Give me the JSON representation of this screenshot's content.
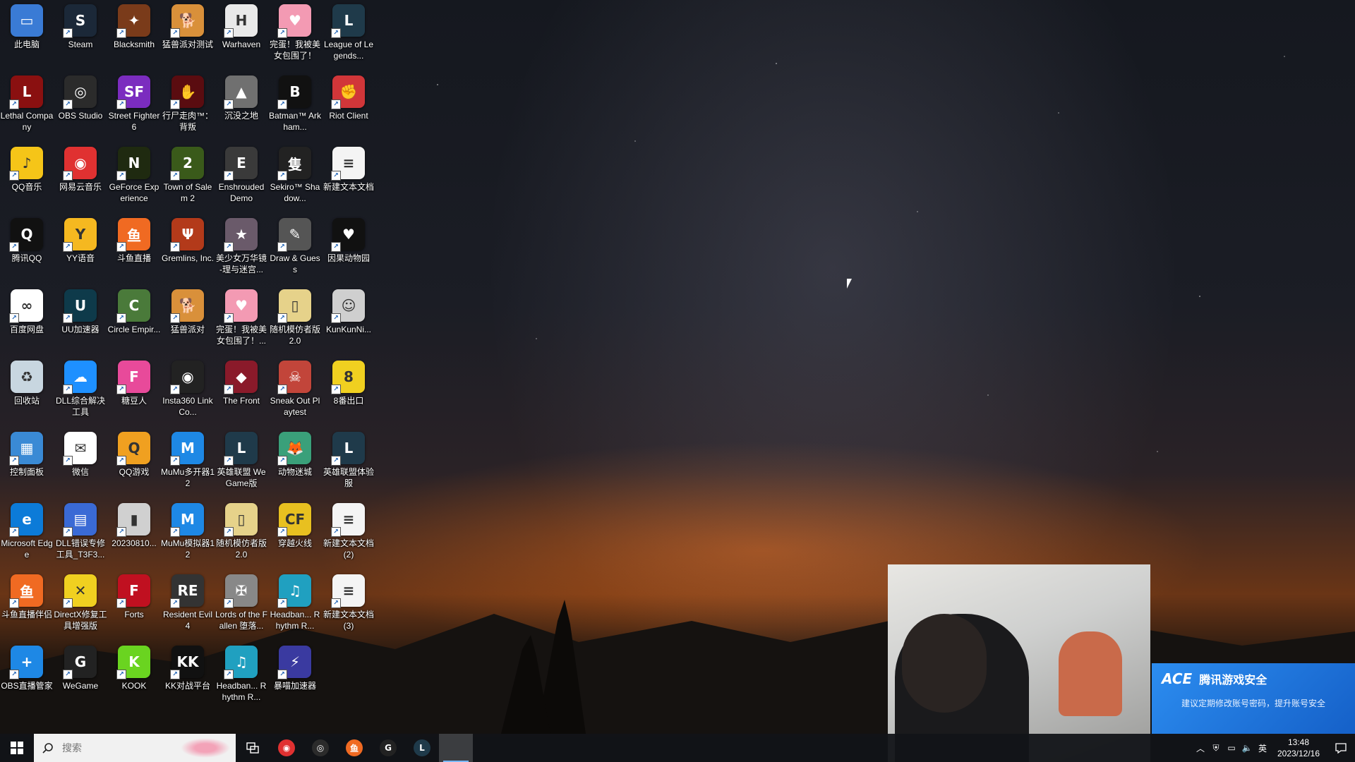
{
  "desktop": {
    "icons": [
      {
        "label": "此电脑",
        "color": "#3a7bd5",
        "glyph": "▭"
      },
      {
        "label": "Steam",
        "color": "#1b2838",
        "glyph": "S"
      },
      {
        "label": "Blacksmith",
        "color": "#7a3b1a",
        "glyph": "✦"
      },
      {
        "label": "猛兽派对测试",
        "color": "#d9903a",
        "glyph": "🐕"
      },
      {
        "label": "Warhaven",
        "color": "#e9e9e9",
        "glyph": "H"
      },
      {
        "label": "完蛋！我被美女包围了！",
        "color": "#f39ab3",
        "glyph": "♥"
      },
      {
        "label": "League of Legends...",
        "color": "#1f3a4a",
        "glyph": "L"
      },
      {
        "label": "Lethal Company",
        "color": "#8a1010",
        "glyph": "L"
      },
      {
        "label": "OBS Studio",
        "color": "#2b2b2b",
        "glyph": "◎"
      },
      {
        "label": "Street Fighter 6",
        "color": "#7b2cbf",
        "glyph": "SF"
      },
      {
        "label": "行尸走肉™：背叛",
        "color": "#5a0c10",
        "glyph": "✋"
      },
      {
        "label": "沉没之地",
        "color": "#707070",
        "glyph": "▲"
      },
      {
        "label": "Batman™ Arkham...",
        "color": "#111111",
        "glyph": "B"
      },
      {
        "label": "Riot Client",
        "color": "#d13639",
        "glyph": "✊"
      },
      {
        "label": "QQ音乐",
        "color": "#f5c518",
        "glyph": "♪"
      },
      {
        "label": "网易云音乐",
        "color": "#e03131",
        "glyph": "◉"
      },
      {
        "label": "GeForce Experience",
        "color": "#1f2a10",
        "glyph": "N"
      },
      {
        "label": "Town of Salem 2",
        "color": "#3a5a1a",
        "glyph": "2"
      },
      {
        "label": "Enshrouded Demo",
        "color": "#3a3a3a",
        "glyph": "E"
      },
      {
        "label": "Sekiro™ Shadow...",
        "color": "#222222",
        "glyph": "隻"
      },
      {
        "label": "新建文本文档",
        "color": "#f4f4f4",
        "glyph": "≡"
      },
      {
        "label": "腾讯QQ",
        "color": "#111111",
        "glyph": "Q"
      },
      {
        "label": "YY语音",
        "color": "#f5b820",
        "glyph": "Y"
      },
      {
        "label": "斗鱼直播",
        "color": "#f06a22",
        "glyph": "鱼"
      },
      {
        "label": "Gremlins, Inc.",
        "color": "#b33a1a",
        "glyph": "Ψ"
      },
      {
        "label": "美少女万华镜 -理与迷宫...",
        "color": "#6a5a6a",
        "glyph": "★"
      },
      {
        "label": "Draw & Guess",
        "color": "#555555",
        "glyph": "✎"
      },
      {
        "label": "因果动物园",
        "color": "#111111",
        "glyph": "♥"
      },
      {
        "label": "百度网盘",
        "color": "#ffffff",
        "glyph": "∞"
      },
      {
        "label": "UU加速器",
        "color": "#0e3a4a",
        "glyph": "U"
      },
      {
        "label": "Circle Empir...",
        "color": "#4a7a3a",
        "glyph": "C"
      },
      {
        "label": "猛兽派对",
        "color": "#d9903a",
        "glyph": "🐕"
      },
      {
        "label": "完蛋！我被美女包围了！...",
        "color": "#f39ab3",
        "glyph": "♥"
      },
      {
        "label": "随机模仿者版 2.0",
        "color": "#e6d28a",
        "glyph": "▯"
      },
      {
        "label": "KunKunNi...",
        "color": "#cfcfcf",
        "glyph": "☺"
      },
      {
        "label": "回收站",
        "color": "#c8d6e0",
        "glyph": "♻"
      },
      {
        "label": "DLL综合解决工具",
        "color": "#1e90ff",
        "glyph": "☁"
      },
      {
        "label": "糖豆人",
        "color": "#e84a9a",
        "glyph": "F"
      },
      {
        "label": "Insta360 Link Co...",
        "color": "#222222",
        "glyph": "◉"
      },
      {
        "label": "The Front",
        "color": "#8a1a2a",
        "glyph": "◆"
      },
      {
        "label": "Sneak Out Playtest",
        "color": "#c2453a",
        "glyph": "☠"
      },
      {
        "label": "8番出口",
        "color": "#f0d020",
        "glyph": "8"
      },
      {
        "label": "控制面板",
        "color": "#3a8ad5",
        "glyph": "▦"
      },
      {
        "label": "微信",
        "color": "#ffffff",
        "glyph": "✉"
      },
      {
        "label": "QQ游戏",
        "color": "#f0a020",
        "glyph": "Q"
      },
      {
        "label": "MuMu多开器12",
        "color": "#1e88e5",
        "glyph": "M"
      },
      {
        "label": "英雄联盟 WeGame版",
        "color": "#1f3a4a",
        "glyph": "L"
      },
      {
        "label": "动物迷城",
        "color": "#3aa07a",
        "glyph": "🦊"
      },
      {
        "label": "英雄联盟体验服",
        "color": "#1f3a4a",
        "glyph": "L"
      },
      {
        "label": "Microsoft Edge",
        "color": "#0c7bd8",
        "glyph": "e"
      },
      {
        "label": "DLL错误专修工具_T3F3...",
        "color": "#3a6ad5",
        "glyph": "▤"
      },
      {
        "label": "20230810...",
        "color": "#d0d0d0",
        "glyph": "▮"
      },
      {
        "label": "MuMu模拟器12",
        "color": "#1e88e5",
        "glyph": "M"
      },
      {
        "label": "随机模仿者版 2.0",
        "color": "#e6d28a",
        "glyph": "▯"
      },
      {
        "label": "穿越火线",
        "color": "#e8c020",
        "glyph": "CF"
      },
      {
        "label": "新建文本文档 (2)",
        "color": "#f4f4f4",
        "glyph": "≡"
      },
      {
        "label": "斗鱼直播伴侣",
        "color": "#f06a22",
        "glyph": "鱼"
      },
      {
        "label": "DirectX修复工具增强版",
        "color": "#f0d020",
        "glyph": "✕"
      },
      {
        "label": "Forts",
        "color": "#c01020",
        "glyph": "F"
      },
      {
        "label": "Resident Evil 4",
        "color": "#333333",
        "glyph": "RE"
      },
      {
        "label": "Lords of the Fallen 堕落...",
        "color": "#888888",
        "glyph": "✠"
      },
      {
        "label": "Headban... Rhythm R...",
        "color": "#20a0c0",
        "glyph": "♫"
      },
      {
        "label": "新建文本文档 (3)",
        "color": "#f4f4f4",
        "glyph": "≡"
      },
      {
        "label": "OBS直播管家",
        "color": "#1e88e5",
        "glyph": "+"
      },
      {
        "label": "WeGame",
        "color": "#222222",
        "glyph": "G"
      },
      {
        "label": "KOOK",
        "color": "#6ad420",
        "glyph": "K"
      },
      {
        "label": "KK对战平台",
        "color": "#111111",
        "glyph": "KK"
      },
      {
        "label": "Headban... Rhythm R...",
        "color": "#20a0c0",
        "glyph": "♫"
      },
      {
        "label": "暴喵加速器",
        "color": "#3a3aa0",
        "glyph": "⚡"
      }
    ]
  },
  "notification": {
    "title": "腾讯游戏安全",
    "logo_text": "ACE",
    "body": "建议定期修改账号密码，提升账号安全"
  },
  "taskbar": {
    "search_placeholder": "搜索",
    "apps": [
      {
        "name": "netease-music",
        "color": "#e03131",
        "glyph": "◉",
        "active": false
      },
      {
        "name": "obs",
        "color": "#2b2b2b",
        "glyph": "◎",
        "active": false
      },
      {
        "name": "douyu",
        "color": "#f06a22",
        "glyph": "鱼",
        "active": false
      },
      {
        "name": "google",
        "color": "#222222",
        "glyph": "G",
        "active": false
      },
      {
        "name": "league",
        "color": "#1f3a4a",
        "glyph": "L",
        "active": false
      },
      {
        "name": "blank",
        "color": "transparent",
        "glyph": "",
        "active": true
      }
    ],
    "ime": "英",
    "time": "13:48",
    "date": "2023/12/16"
  }
}
